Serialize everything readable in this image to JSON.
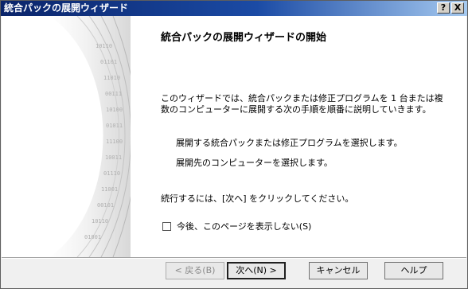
{
  "window": {
    "title": "統合パックの展開ウィザード",
    "help_button": "?",
    "close_button": "X"
  },
  "main": {
    "heading": "統合パックの展開ウィザードの開始",
    "description": "このウィザードでは、統合パックまたは修正プログラムを 1 台または複数のコンピューターに展開する次の手順を順番に説明していきます。",
    "steps": [
      "展開する統合パックまたは修正プログラムを選択します。",
      "展開先のコンピューターを選択します。"
    ],
    "continue_text": "続行するには、[次へ] をクリックしてください。",
    "checkbox_label": "今後、このページを表示しない(S)",
    "checkbox_checked": false
  },
  "buttons": {
    "back": "< 戻る(B)",
    "next": "次へ(N) >",
    "cancel": "キャンセル",
    "help": "ヘルプ"
  }
}
